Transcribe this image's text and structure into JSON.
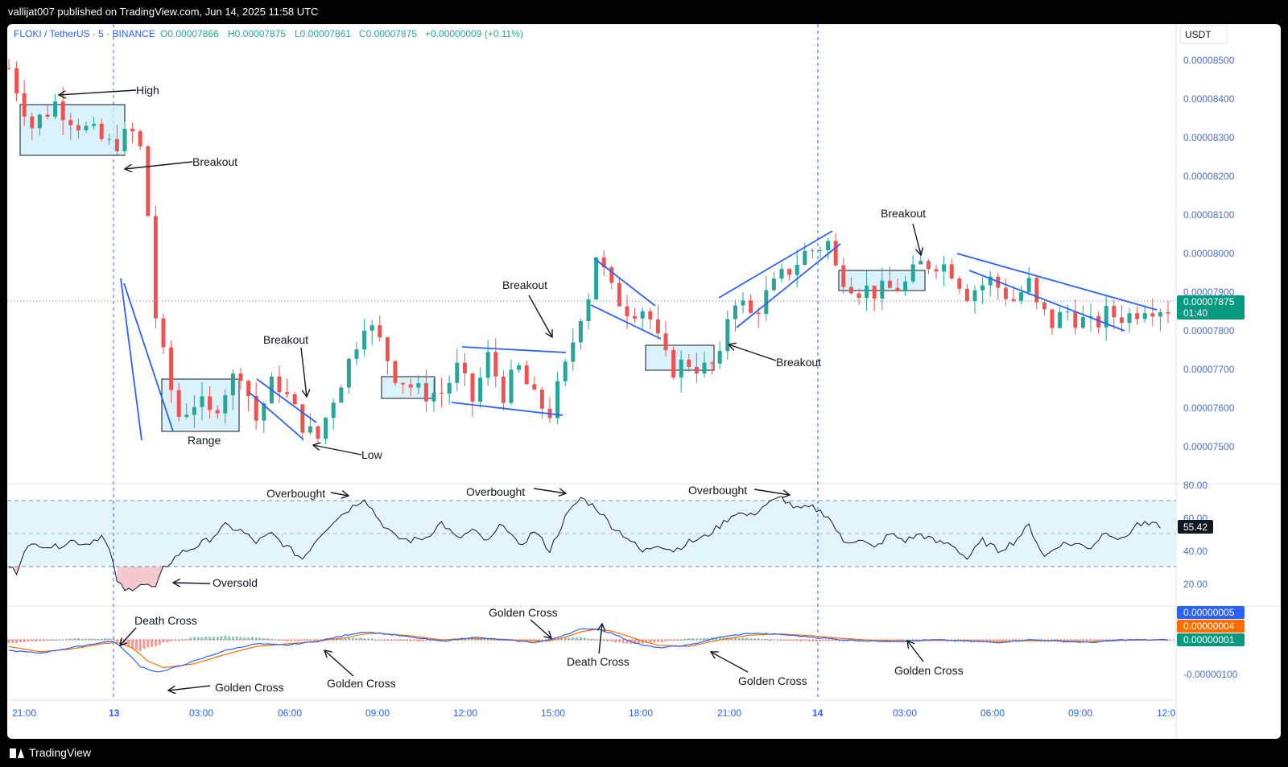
{
  "topbar": {
    "publisher": "vallijat007 published on TradingView.com, Jun 14, 2025 11:58 UTC"
  },
  "footer": {
    "brand": "TradingView"
  },
  "colors": {
    "up": "#26a69a",
    "down": "#ef5350",
    "blue": "#2962ff",
    "orange": "#ff6d00",
    "rsi_band": "#e3f5fb",
    "box_fill": "#cdeefa"
  },
  "chart_data": {
    "type": "candlestick",
    "legend": {
      "symbol": "FLOKI / TetherUS · 5 · BINANCE",
      "open": "O0.00007866",
      "high": "H0.00007875",
      "low": "L0.00007861",
      "close": "C0.00007875",
      "change": "+0.00000009 (+0.11%)"
    },
    "currency": "USDT",
    "price_axis": {
      "ticks": [
        "0.00008500",
        "0.00008400",
        "0.00008300",
        "0.00008200",
        "0.00008100",
        "0.00008000",
        "0.00007900",
        "0.00007800",
        "0.00007700",
        "0.00007600",
        "0.00007500"
      ],
      "ylim": [
        7.45e-05,
        8.57e-05
      ]
    },
    "last_price": {
      "value": "0.00007875",
      "countdown": "01:40"
    },
    "time_axis": {
      "labels": [
        "21:00",
        "13",
        "03:00",
        "06:00",
        "09:00",
        "12:00",
        "15:00",
        "18:00",
        "21:00",
        "14",
        "03:00",
        "06:00",
        "09:00",
        "12:0"
      ]
    },
    "price_path": [
      [
        0,
        8.48e-05
      ],
      [
        3,
        8.33e-05
      ],
      [
        6,
        8.39e-05
      ],
      [
        10,
        8.32e-05
      ],
      [
        13,
        8.28e-05
      ],
      [
        16,
        8.31e-05
      ],
      [
        17.2,
        8.26e-05
      ],
      [
        18,
        8.1e-05
      ],
      [
        18.5,
        7.9e-05
      ],
      [
        19.3,
        7.8e-05
      ],
      [
        20.5,
        7.68e-05
      ],
      [
        22,
        7.58e-05
      ],
      [
        24.2,
        7.62e-05
      ],
      [
        26,
        7.58e-05
      ],
      [
        28,
        7.65e-05
      ],
      [
        30,
        7.7e-05
      ],
      [
        32,
        7.57e-05
      ],
      [
        34.5,
        7.68e-05
      ],
      [
        37,
        7.59e-05
      ],
      [
        39.8,
        7.51e-05
      ],
      [
        42,
        7.63e-05
      ],
      [
        44,
        7.72e-05
      ],
      [
        46,
        7.83e-05
      ],
      [
        48,
        7.77e-05
      ],
      [
        50,
        7.69e-05
      ],
      [
        53,
        7.64e-05
      ],
      [
        56,
        7.64e-05
      ],
      [
        58,
        7.7e-05
      ],
      [
        60,
        7.62e-05
      ],
      [
        62,
        7.73e-05
      ],
      [
        64,
        7.64e-05
      ],
      [
        66,
        7.7e-05
      ],
      [
        68,
        7.62e-05
      ],
      [
        70,
        7.59e-05
      ],
      [
        72,
        7.7e-05
      ],
      [
        74,
        7.85e-05
      ],
      [
        75.3,
        7.91e-05
      ],
      [
        76,
        8e-05
      ],
      [
        78,
        7.9e-05
      ],
      [
        80,
        7.86e-05
      ],
      [
        82.5,
        7.86e-05
      ],
      [
        84,
        7.77e-05
      ],
      [
        85.5,
        7.7e-05
      ],
      [
        88,
        7.72e-05
      ],
      [
        90,
        7.7e-05
      ],
      [
        92,
        7.72e-05
      ],
      [
        93.5,
        7.9e-05
      ],
      [
        96,
        7.84e-05
      ],
      [
        98,
        7.89e-05
      ],
      [
        101,
        7.96e-05
      ],
      [
        103,
        8e-05
      ],
      [
        105,
        8.02e-05
      ],
      [
        106.2,
        8.03e-05
      ],
      [
        107,
        7.96e-05
      ],
      [
        110,
        7.91e-05
      ],
      [
        113,
        7.9e-05
      ],
      [
        116,
        7.92e-05
      ],
      [
        118,
        7.97e-05
      ],
      [
        120,
        7.98e-05
      ],
      [
        122,
        7.96e-05
      ],
      [
        124,
        7.9e-05
      ],
      [
        127,
        7.93e-05
      ],
      [
        130,
        7.88e-05
      ],
      [
        132,
        7.92e-05
      ],
      [
        133,
        7.86e-05
      ],
      [
        135,
        7.82e-05
      ],
      [
        137,
        7.85e-05
      ],
      [
        140,
        7.81e-05
      ],
      [
        142,
        7.84e-05
      ],
      [
        145,
        7.84e-05
      ],
      [
        147,
        7.87e-05
      ],
      [
        150,
        7.86e-05
      ]
    ],
    "rsi": {
      "ticks": [
        "80.00",
        "60.00",
        "40.00",
        "20.00"
      ],
      "levels": [
        70,
        50,
        30
      ],
      "current": "55.42",
      "path": [
        [
          0,
          30
        ],
        [
          1,
          27
        ],
        [
          2,
          41
        ],
        [
          4,
          44
        ],
        [
          6,
          42
        ],
        [
          8,
          46
        ],
        [
          10,
          44
        ],
        [
          12,
          49
        ],
        [
          13,
          40
        ],
        [
          14,
          22
        ],
        [
          15,
          15
        ],
        [
          17,
          20
        ],
        [
          19,
          17
        ],
        [
          20,
          29
        ],
        [
          22,
          38
        ],
        [
          24,
          42
        ],
        [
          26,
          47
        ],
        [
          28,
          55
        ],
        [
          30,
          52
        ],
        [
          32,
          45
        ],
        [
          34,
          50
        ],
        [
          36,
          42
        ],
        [
          38,
          35
        ],
        [
          40,
          48
        ],
        [
          42,
          58
        ],
        [
          44,
          65
        ],
        [
          46,
          72
        ],
        [
          48,
          58
        ],
        [
          50,
          48
        ],
        [
          52,
          46
        ],
        [
          54,
          48
        ],
        [
          56,
          57
        ],
        [
          58,
          47
        ],
        [
          60,
          52
        ],
        [
          62,
          45
        ],
        [
          64,
          57
        ],
        [
          66,
          42
        ],
        [
          68,
          52
        ],
        [
          70,
          40
        ],
        [
          72,
          60
        ],
        [
          74,
          72
        ],
        [
          76,
          66
        ],
        [
          78,
          55
        ],
        [
          80,
          48
        ],
        [
          82,
          39
        ],
        [
          84,
          44
        ],
        [
          86,
          40
        ],
        [
          88,
          45
        ],
        [
          90,
          48
        ],
        [
          92,
          55
        ],
        [
          94,
          63
        ],
        [
          96,
          61
        ],
        [
          98,
          68
        ],
        [
          100,
          72
        ],
        [
          102,
          65
        ],
        [
          104,
          66
        ],
        [
          106,
          61
        ],
        [
          108,
          45
        ],
        [
          110,
          47
        ],
        [
          112,
          41
        ],
        [
          114,
          50
        ],
        [
          116,
          46
        ],
        [
          118,
          50
        ],
        [
          120,
          45
        ],
        [
          122,
          44
        ],
        [
          124,
          35
        ],
        [
          126,
          46
        ],
        [
          128,
          40
        ],
        [
          130,
          45
        ],
        [
          132,
          55
        ],
        [
          134,
          36
        ],
        [
          136,
          44
        ],
        [
          138,
          44
        ],
        [
          140,
          42
        ],
        [
          142,
          52
        ],
        [
          144,
          46
        ],
        [
          146,
          56
        ],
        [
          149,
          55
        ]
      ]
    },
    "macd": {
      "labels": [
        "0.00000005",
        "0.00000004",
        "0.00000001",
        "-0.00000100"
      ],
      "macd_path": [
        [
          0,
          -40
        ],
        [
          4,
          -50
        ],
        [
          8,
          -30
        ],
        [
          12,
          -10
        ],
        [
          13.5,
          -5
        ],
        [
          15,
          -40
        ],
        [
          17,
          -100
        ],
        [
          19,
          -120
        ],
        [
          20,
          -118
        ],
        [
          24,
          -80
        ],
        [
          28,
          -40
        ],
        [
          32,
          -15
        ],
        [
          36,
          -20
        ],
        [
          40,
          -5
        ],
        [
          44,
          20
        ],
        [
          46,
          30
        ],
        [
          48,
          25
        ],
        [
          52,
          10
        ],
        [
          56,
          -5
        ],
        [
          60,
          10
        ],
        [
          64,
          0
        ],
        [
          68,
          -10
        ],
        [
          70,
          0
        ],
        [
          72,
          20
        ],
        [
          74,
          40
        ],
        [
          76,
          42
        ],
        [
          78,
          25
        ],
        [
          80,
          0
        ],
        [
          82,
          -20
        ],
        [
          84,
          -30
        ],
        [
          88,
          -20
        ],
        [
          92,
          10
        ],
        [
          96,
          25
        ],
        [
          100,
          20
        ],
        [
          104,
          10
        ],
        [
          108,
          0
        ],
        [
          112,
          -5
        ],
        [
          116,
          -5
        ],
        [
          120,
          0
        ],
        [
          124,
          -5
        ],
        [
          128,
          -10
        ],
        [
          132,
          0
        ],
        [
          136,
          -5
        ],
        [
          140,
          -10
        ],
        [
          144,
          0
        ],
        [
          150,
          0
        ]
      ],
      "signal_path": [
        [
          0,
          -25
        ],
        [
          4,
          -45
        ],
        [
          8,
          -35
        ],
        [
          12,
          -15
        ],
        [
          14,
          -10
        ],
        [
          16,
          -30
        ],
        [
          18,
          -80
        ],
        [
          20,
          -105
        ],
        [
          24,
          -90
        ],
        [
          28,
          -55
        ],
        [
          32,
          -25
        ],
        [
          36,
          -15
        ],
        [
          40,
          -5
        ],
        [
          44,
          10
        ],
        [
          46,
          22
        ],
        [
          48,
          25
        ],
        [
          52,
          15
        ],
        [
          56,
          0
        ],
        [
          60,
          5
        ],
        [
          64,
          2
        ],
        [
          68,
          -5
        ],
        [
          70,
          -3
        ],
        [
          72,
          10
        ],
        [
          74,
          30
        ],
        [
          76,
          40
        ],
        [
          78,
          33
        ],
        [
          80,
          15
        ],
        [
          82,
          -5
        ],
        [
          84,
          -20
        ],
        [
          88,
          -25
        ],
        [
          92,
          0
        ],
        [
          96,
          18
        ],
        [
          100,
          22
        ],
        [
          104,
          15
        ],
        [
          108,
          5
        ],
        [
          112,
          -2
        ],
        [
          116,
          -4
        ],
        [
          120,
          -2
        ],
        [
          124,
          -3
        ],
        [
          128,
          -7
        ],
        [
          132,
          -3
        ],
        [
          136,
          -4
        ],
        [
          140,
          -7
        ],
        [
          144,
          -2
        ],
        [
          150,
          0
        ]
      ]
    },
    "annotations": {
      "high": "High",
      "breakout_1": "Breakout",
      "range": "Range",
      "breakout_2": "Breakout",
      "low": "Low",
      "breakout_3": "Breakout",
      "breakout_4": "Breakout",
      "breakout_5": "Breakout",
      "overbought_1": "Overbought",
      "overbought_2": "Overbought",
      "overbought_3": "Overbought",
      "oversold": "Oversold",
      "death_cross_1": "Death Cross",
      "golden_cross_1": "Golden Cross",
      "golden_cross_2": "Golden Cross",
      "golden_cross_3": "Golden Cross",
      "death_cross_2": "Death Cross",
      "golden_cross_4": "Golden Cross",
      "golden_cross_5": "Golden Cross"
    }
  }
}
